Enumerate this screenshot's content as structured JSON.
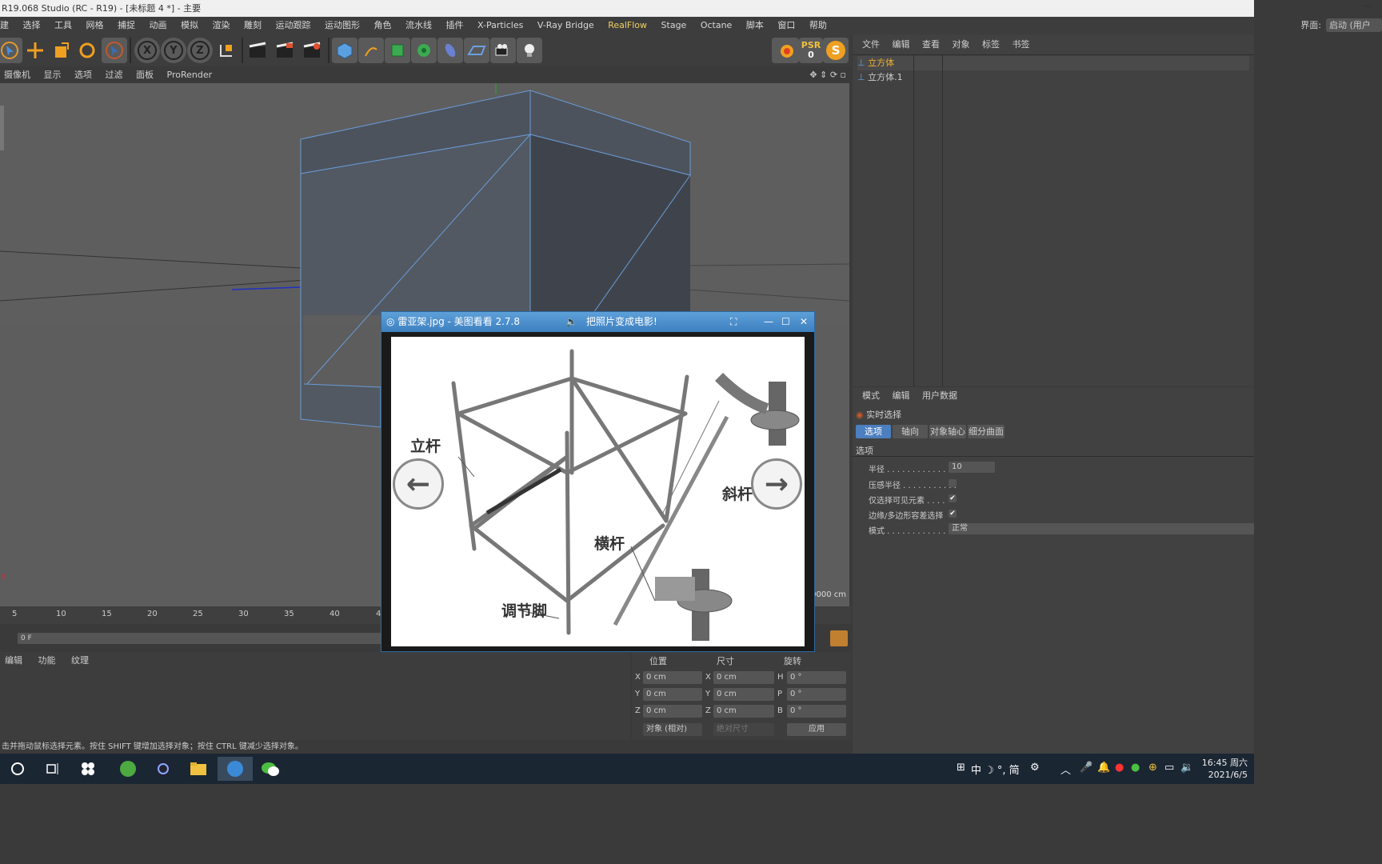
{
  "window": {
    "title": "R19.068 Studio (RC - R19) - [未标题 4 *] - 主要",
    "min_glyph": "—"
  },
  "menubar": {
    "items": [
      "建",
      "选择",
      "工具",
      "网格",
      "捕捉",
      "动画",
      "模拟",
      "渲染",
      "雕刻",
      "运动跟踪",
      "运动图形",
      "角色",
      "流水线",
      "插件",
      "X-Particles",
      "V-Ray Bridge",
      "RealFlow",
      "Stage",
      "Octane",
      "脚本",
      "窗口",
      "帮助"
    ],
    "highlight": "RealFlow",
    "layout_label": "界面:",
    "layout_value": "启动 (用户"
  },
  "toolbar": {
    "axis_x": "X",
    "axis_y": "Y",
    "axis_z": "Z",
    "psr_label": "PSR",
    "psr_value": "0",
    "s_label": "S"
  },
  "view_menu": [
    "摄像机",
    "显示",
    "选项",
    "过滤",
    "面板",
    "ProRender"
  ],
  "viewport": {
    "grid_readout": "0000 cm"
  },
  "timeline": {
    "ticks": [
      "5",
      "10",
      "15",
      "20",
      "25",
      "30",
      "35",
      "40",
      "4"
    ],
    "frame": "0 F"
  },
  "bottom_tabs": [
    "编辑",
    "功能",
    "纹理"
  ],
  "coords": {
    "headers": {
      "position": "位置",
      "size": "尺寸",
      "rotation": "旋转"
    },
    "pos": [
      {
        "axis": "X",
        "value": "0 cm"
      },
      {
        "axis": "Y",
        "value": "0 cm"
      },
      {
        "axis": "Z",
        "value": "0 cm"
      }
    ],
    "size": [
      {
        "axis": "X",
        "value": "0 cm"
      },
      {
        "axis": "Y",
        "value": "0 cm"
      },
      {
        "axis": "Z",
        "value": "0 cm"
      }
    ],
    "rot": [
      {
        "axis": "H",
        "value": "0 °"
      },
      {
        "axis": "P",
        "value": "0 °"
      },
      {
        "axis": "B",
        "value": "0 °"
      }
    ],
    "mode_select": "对象 (相对)",
    "size_select": "绝对尺寸",
    "apply": "应用"
  },
  "status": "击并拖动鼠标选择元素。按住 SHIFT 键增加选择对象；按住 CTRL 键减少选择对象。",
  "object_manager": {
    "menu": [
      "文件",
      "编辑",
      "查看",
      "对象",
      "标签",
      "书签"
    ],
    "objects": [
      {
        "name": "立方体",
        "selected": true
      },
      {
        "name": "立方体.1",
        "selected": false
      }
    ]
  },
  "attribute_manager": {
    "menu": [
      "模式",
      "编辑",
      "用户数据"
    ],
    "tool_name": "实时选择",
    "tabs": [
      "选项",
      "轴向",
      "对象轴心",
      "细分曲面"
    ],
    "section": "选项",
    "rows": [
      {
        "label": "半径 . . . . . . . . . . . . . .",
        "value": "10"
      },
      {
        "label": "压感半径 . . . . . . . . . . .",
        "value": ""
      },
      {
        "label": "仅选择可见元素 . . . .",
        "value": "✔"
      },
      {
        "label": "边缘/多边形容差选择",
        "value": "✔"
      },
      {
        "label": "模式 . . . . . . . . . . . . . .",
        "value": "正常"
      }
    ]
  },
  "viewer": {
    "title": "雷亚架.jpg - 美图看看 2.7.8",
    "promo": "把照片变成电影!",
    "labels": {
      "upright": "立杆",
      "diagonal": "斜杆",
      "crossbar": "横杆",
      "foot": "调节脚"
    }
  },
  "taskbar": {
    "tray_text": "中 ☽ °, 简",
    "time": "16:45 周六",
    "date": "2021/6/5"
  }
}
